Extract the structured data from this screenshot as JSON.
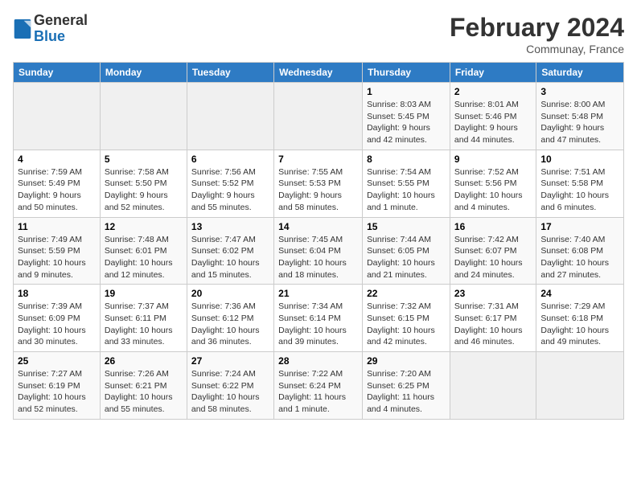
{
  "header": {
    "logo_general": "General",
    "logo_blue": "Blue",
    "month_title": "February 2024",
    "location": "Communay, France"
  },
  "columns": [
    "Sunday",
    "Monday",
    "Tuesday",
    "Wednesday",
    "Thursday",
    "Friday",
    "Saturday"
  ],
  "weeks": [
    [
      {
        "day": "",
        "info": ""
      },
      {
        "day": "",
        "info": ""
      },
      {
        "day": "",
        "info": ""
      },
      {
        "day": "",
        "info": ""
      },
      {
        "day": "1",
        "info": "Sunrise: 8:03 AM\nSunset: 5:45 PM\nDaylight: 9 hours and 42 minutes."
      },
      {
        "day": "2",
        "info": "Sunrise: 8:01 AM\nSunset: 5:46 PM\nDaylight: 9 hours and 44 minutes."
      },
      {
        "day": "3",
        "info": "Sunrise: 8:00 AM\nSunset: 5:48 PM\nDaylight: 9 hours and 47 minutes."
      }
    ],
    [
      {
        "day": "4",
        "info": "Sunrise: 7:59 AM\nSunset: 5:49 PM\nDaylight: 9 hours and 50 minutes."
      },
      {
        "day": "5",
        "info": "Sunrise: 7:58 AM\nSunset: 5:50 PM\nDaylight: 9 hours and 52 minutes."
      },
      {
        "day": "6",
        "info": "Sunrise: 7:56 AM\nSunset: 5:52 PM\nDaylight: 9 hours and 55 minutes."
      },
      {
        "day": "7",
        "info": "Sunrise: 7:55 AM\nSunset: 5:53 PM\nDaylight: 9 hours and 58 minutes."
      },
      {
        "day": "8",
        "info": "Sunrise: 7:54 AM\nSunset: 5:55 PM\nDaylight: 10 hours and 1 minute."
      },
      {
        "day": "9",
        "info": "Sunrise: 7:52 AM\nSunset: 5:56 PM\nDaylight: 10 hours and 4 minutes."
      },
      {
        "day": "10",
        "info": "Sunrise: 7:51 AM\nSunset: 5:58 PM\nDaylight: 10 hours and 6 minutes."
      }
    ],
    [
      {
        "day": "11",
        "info": "Sunrise: 7:49 AM\nSunset: 5:59 PM\nDaylight: 10 hours and 9 minutes."
      },
      {
        "day": "12",
        "info": "Sunrise: 7:48 AM\nSunset: 6:01 PM\nDaylight: 10 hours and 12 minutes."
      },
      {
        "day": "13",
        "info": "Sunrise: 7:47 AM\nSunset: 6:02 PM\nDaylight: 10 hours and 15 minutes."
      },
      {
        "day": "14",
        "info": "Sunrise: 7:45 AM\nSunset: 6:04 PM\nDaylight: 10 hours and 18 minutes."
      },
      {
        "day": "15",
        "info": "Sunrise: 7:44 AM\nSunset: 6:05 PM\nDaylight: 10 hours and 21 minutes."
      },
      {
        "day": "16",
        "info": "Sunrise: 7:42 AM\nSunset: 6:07 PM\nDaylight: 10 hours and 24 minutes."
      },
      {
        "day": "17",
        "info": "Sunrise: 7:40 AM\nSunset: 6:08 PM\nDaylight: 10 hours and 27 minutes."
      }
    ],
    [
      {
        "day": "18",
        "info": "Sunrise: 7:39 AM\nSunset: 6:09 PM\nDaylight: 10 hours and 30 minutes."
      },
      {
        "day": "19",
        "info": "Sunrise: 7:37 AM\nSunset: 6:11 PM\nDaylight: 10 hours and 33 minutes."
      },
      {
        "day": "20",
        "info": "Sunrise: 7:36 AM\nSunset: 6:12 PM\nDaylight: 10 hours and 36 minutes."
      },
      {
        "day": "21",
        "info": "Sunrise: 7:34 AM\nSunset: 6:14 PM\nDaylight: 10 hours and 39 minutes."
      },
      {
        "day": "22",
        "info": "Sunrise: 7:32 AM\nSunset: 6:15 PM\nDaylight: 10 hours and 42 minutes."
      },
      {
        "day": "23",
        "info": "Sunrise: 7:31 AM\nSunset: 6:17 PM\nDaylight: 10 hours and 46 minutes."
      },
      {
        "day": "24",
        "info": "Sunrise: 7:29 AM\nSunset: 6:18 PM\nDaylight: 10 hours and 49 minutes."
      }
    ],
    [
      {
        "day": "25",
        "info": "Sunrise: 7:27 AM\nSunset: 6:19 PM\nDaylight: 10 hours and 52 minutes."
      },
      {
        "day": "26",
        "info": "Sunrise: 7:26 AM\nSunset: 6:21 PM\nDaylight: 10 hours and 55 minutes."
      },
      {
        "day": "27",
        "info": "Sunrise: 7:24 AM\nSunset: 6:22 PM\nDaylight: 10 hours and 58 minutes."
      },
      {
        "day": "28",
        "info": "Sunrise: 7:22 AM\nSunset: 6:24 PM\nDaylight: 11 hours and 1 minute."
      },
      {
        "day": "29",
        "info": "Sunrise: 7:20 AM\nSunset: 6:25 PM\nDaylight: 11 hours and 4 minutes."
      },
      {
        "day": "",
        "info": ""
      },
      {
        "day": "",
        "info": ""
      }
    ]
  ]
}
